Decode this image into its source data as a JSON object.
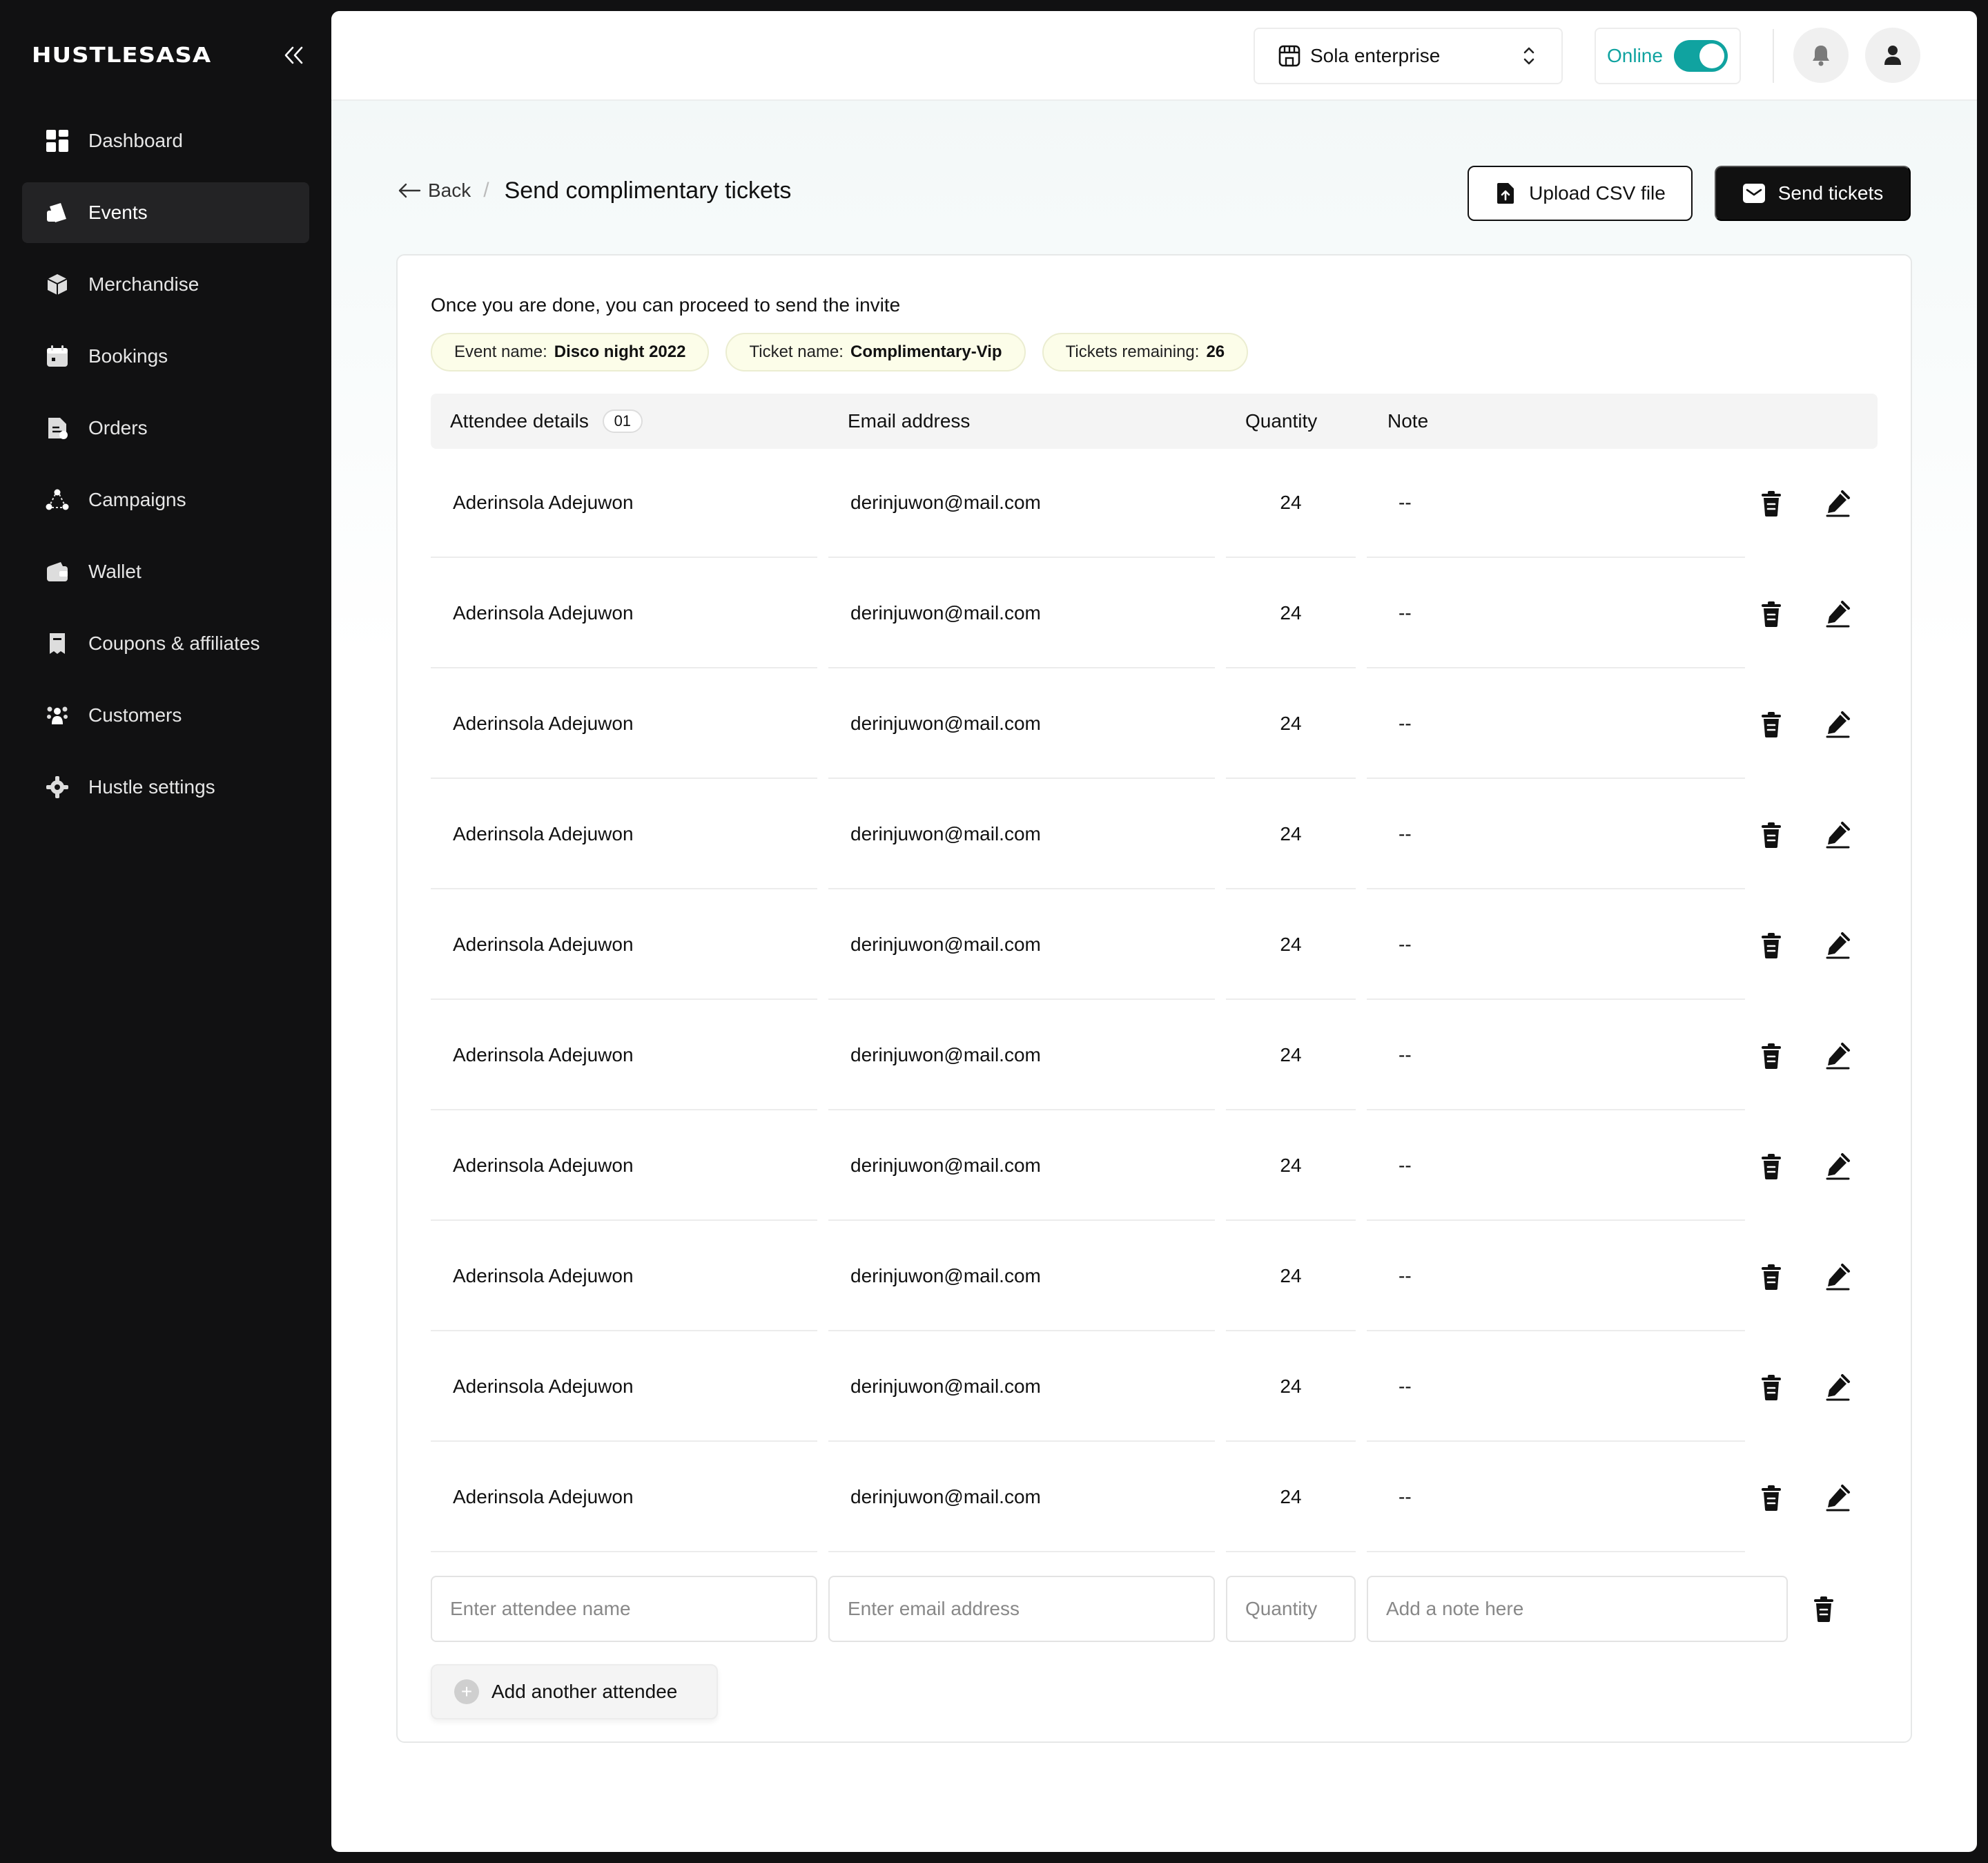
{
  "brand": {
    "logo_text": "HUSTLESASA"
  },
  "sidebar": {
    "items": [
      {
        "label": "Dashboard",
        "icon": "grid-icon",
        "active": false
      },
      {
        "label": "Events",
        "icon": "ticket-icon",
        "active": true
      },
      {
        "label": "Merchandise",
        "icon": "box-icon",
        "active": false
      },
      {
        "label": "Bookings",
        "icon": "calendar-icon",
        "active": false
      },
      {
        "label": "Orders",
        "icon": "document-icon",
        "active": false
      },
      {
        "label": "Campaigns",
        "icon": "share-icon",
        "active": false
      },
      {
        "label": "Wallet",
        "icon": "wallet-icon",
        "active": false
      },
      {
        "label": "Coupons & affiliates",
        "icon": "coupon-icon",
        "active": false
      },
      {
        "label": "Customers",
        "icon": "users-icon",
        "active": false
      },
      {
        "label": "Hustle settings",
        "icon": "gear-icon",
        "active": false
      }
    ]
  },
  "topbar": {
    "org_name": "Sola enterprise",
    "status_label": "Online",
    "status_on": true
  },
  "header": {
    "back_label": "Back",
    "separator": "/",
    "title": "Send complimentary tickets",
    "upload_label": "Upload CSV file",
    "send_label": "Send tickets"
  },
  "card": {
    "intro": "Once you are done, you can proceed to send the invite",
    "pills": [
      {
        "key": "Event name:",
        "value": "Disco night 2022"
      },
      {
        "key": "Ticket name:",
        "value": "Complimentary-Vip"
      },
      {
        "key": "Tickets remaining:",
        "value": "26"
      }
    ]
  },
  "table": {
    "columns": {
      "attendee": "Attendee details",
      "attendee_count": "01",
      "email": "Email address",
      "quantity": "Quantity",
      "note": "Note"
    },
    "rows": [
      {
        "name": "Aderinsola Adejuwon",
        "email": "derinjuwon@mail.com",
        "quantity": "24",
        "note": "--"
      },
      {
        "name": "Aderinsola Adejuwon",
        "email": "derinjuwon@mail.com",
        "quantity": "24",
        "note": "--"
      },
      {
        "name": "Aderinsola Adejuwon",
        "email": "derinjuwon@mail.com",
        "quantity": "24",
        "note": "--"
      },
      {
        "name": "Aderinsola Adejuwon",
        "email": "derinjuwon@mail.com",
        "quantity": "24",
        "note": "--"
      },
      {
        "name": "Aderinsola Adejuwon",
        "email": "derinjuwon@mail.com",
        "quantity": "24",
        "note": "--"
      },
      {
        "name": "Aderinsola Adejuwon",
        "email": "derinjuwon@mail.com",
        "quantity": "24",
        "note": "--"
      },
      {
        "name": "Aderinsola Adejuwon",
        "email": "derinjuwon@mail.com",
        "quantity": "24",
        "note": "--"
      },
      {
        "name": "Aderinsola Adejuwon",
        "email": "derinjuwon@mail.com",
        "quantity": "24",
        "note": "--"
      },
      {
        "name": "Aderinsola Adejuwon",
        "email": "derinjuwon@mail.com",
        "quantity": "24",
        "note": "--"
      },
      {
        "name": "Aderinsola Adejuwon",
        "email": "derinjuwon@mail.com",
        "quantity": "24",
        "note": "--"
      }
    ]
  },
  "new_row": {
    "name_placeholder": "Enter attendee name",
    "email_placeholder": "Enter email address",
    "quantity_placeholder": "Quantity",
    "note_placeholder": "Add a note here"
  },
  "add_attendee_label": "Add another attendee",
  "colors": {
    "accent": "#10a3a0",
    "sidebar_bg": "#111112",
    "pill_bg": "#fcfde9"
  }
}
